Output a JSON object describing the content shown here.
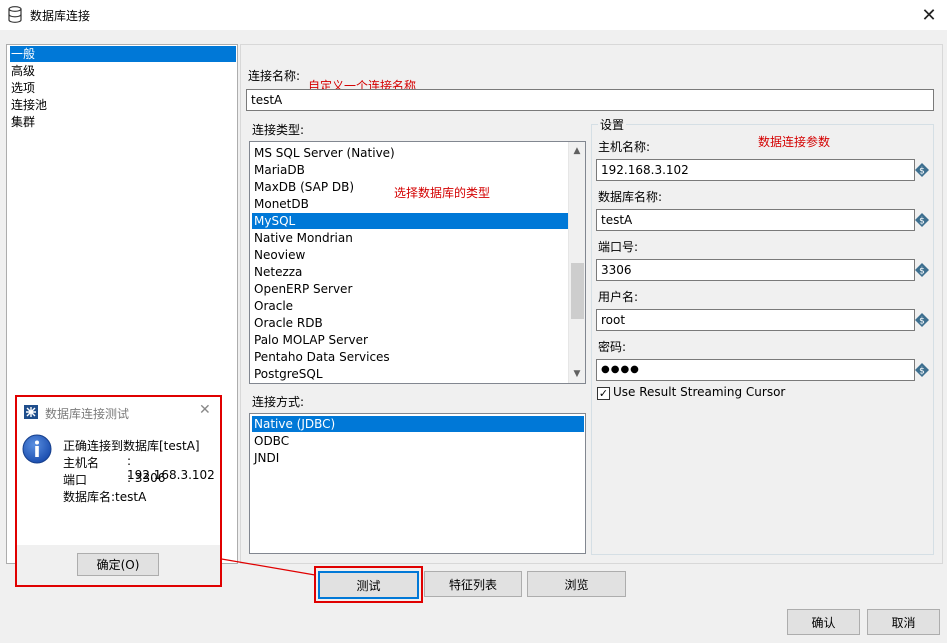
{
  "window": {
    "title": "数据库连接",
    "close_glyph": "✕"
  },
  "nav": {
    "items": [
      "一般",
      "高级",
      "选项",
      "连接池",
      "集群"
    ],
    "selected": "一般"
  },
  "connection_name": {
    "label": "连接名称:",
    "value": "testA",
    "annotation": "自定义一个连接名称"
  },
  "connection_type": {
    "label": "连接类型:",
    "annotation": "选择数据库的类型",
    "items": [
      "MS SQL Server (Native)",
      "MariaDB",
      "MaxDB (SAP DB)",
      "MonetDB",
      "MySQL",
      "Native Mondrian",
      "Neoview",
      "Netezza",
      "OpenERP Server",
      "Oracle",
      "Oracle RDB",
      "Palo MOLAP Server",
      "Pentaho Data Services",
      "PostgreSQL"
    ],
    "selected": "MySQL"
  },
  "access_method": {
    "label": "连接方式:",
    "items": [
      "Native (JDBC)",
      "ODBC",
      "JNDI"
    ],
    "selected": "Native (JDBC)"
  },
  "settings": {
    "group_label": "设置",
    "annotation": "数据连接参数",
    "host_label": "主机名称:",
    "host_value": "192.168.3.102",
    "db_label": "数据库名称:",
    "db_value": "testA",
    "port_label": "端口号:",
    "port_value": "3306",
    "user_label": "用户名:",
    "user_value": "root",
    "password_label": "密码:",
    "password_value": "●●●●",
    "streaming_label": "Use Result Streaming Cursor",
    "streaming_checked": "✓"
  },
  "buttons": {
    "test": "测试",
    "features": "特征列表",
    "explore": "浏览",
    "ok": "确认",
    "cancel": "取消"
  },
  "popup": {
    "title": "数据库连接测试",
    "close_glyph": "✕",
    "message_line1": "正确连接到数据库[testA]",
    "host_key": "主机名",
    "host_val": ": 192.168.3.102",
    "port_key": "端口",
    "port_val": ": 3306",
    "db_line": "数据库名:testA",
    "ok_button": "确定(O)"
  },
  "colors": {
    "selection": "#0078d7",
    "annotation_red": "#d40000",
    "highlight_border": "#e00000"
  }
}
